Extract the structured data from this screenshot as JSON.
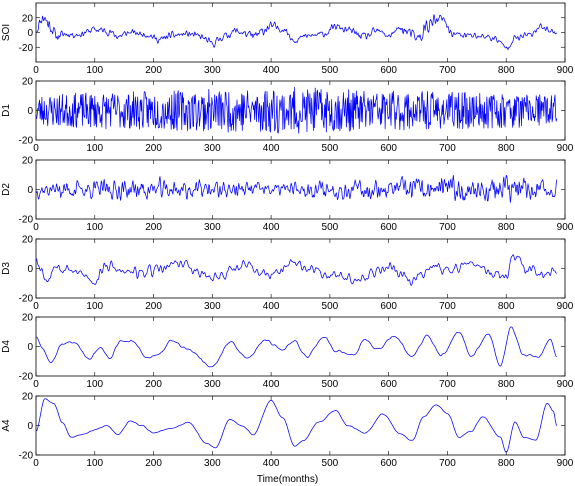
{
  "chart_data": {
    "type": "line",
    "layout": "6 vertically stacked subplots sharing the x axis",
    "xlabel": "Time(months)",
    "xlim": [
      0,
      900
    ],
    "xticks": [
      0,
      100,
      200,
      300,
      400,
      500,
      600,
      700,
      800,
      900
    ],
    "x_data_range": [
      1,
      886
    ],
    "grid": false,
    "line_color": "#0000ff",
    "panels": [
      {
        "ylabel": "SOI",
        "ylim": [
          -40,
          40
        ],
        "yticks": [
          -20,
          0,
          20
        ],
        "key": "soi",
        "envelope": [
          [
            0,
            18
          ],
          [
            15,
            32
          ],
          [
            40,
            14
          ],
          [
            70,
            10
          ],
          [
            100,
            12
          ],
          [
            150,
            12
          ],
          [
            180,
            9
          ],
          [
            250,
            12
          ],
          [
            300,
            12
          ],
          [
            400,
            16
          ],
          [
            420,
            12
          ],
          [
            450,
            9
          ],
          [
            500,
            10
          ],
          [
            550,
            14
          ],
          [
            600,
            10
          ],
          [
            670,
            28
          ],
          [
            700,
            12
          ],
          [
            750,
            11
          ],
          [
            800,
            10
          ],
          [
            850,
            12
          ],
          [
            886,
            8
          ]
        ],
        "anchors": [
          [
            0,
            5
          ],
          [
            12,
            22
          ],
          [
            22,
            12
          ],
          [
            35,
            -5
          ],
          [
            50,
            -2
          ],
          [
            70,
            -3
          ],
          [
            100,
            4
          ],
          [
            120,
            2
          ],
          [
            140,
            -5
          ],
          [
            160,
            0
          ],
          [
            190,
            -3
          ],
          [
            210,
            -10
          ],
          [
            230,
            -4
          ],
          [
            260,
            -2
          ],
          [
            280,
            -6
          ],
          [
            300,
            -15
          ],
          [
            320,
            -5
          ],
          [
            340,
            2
          ],
          [
            370,
            -5
          ],
          [
            400,
            8
          ],
          [
            420,
            5
          ],
          [
            440,
            -10
          ],
          [
            460,
            -5
          ],
          [
            490,
            -2
          ],
          [
            510,
            8
          ],
          [
            530,
            3
          ],
          [
            560,
            -6
          ],
          [
            580,
            2
          ],
          [
            600,
            -4
          ],
          [
            620,
            5
          ],
          [
            650,
            -8
          ],
          [
            670,
            12
          ],
          [
            690,
            18
          ],
          [
            710,
            -2
          ],
          [
            730,
            -4
          ],
          [
            760,
            -5
          ],
          [
            780,
            -8
          ],
          [
            800,
            -20
          ],
          [
            815,
            -8
          ],
          [
            840,
            -3
          ],
          [
            860,
            8
          ],
          [
            886,
            0
          ]
        ]
      },
      {
        "ylabel": "D1",
        "ylim": [
          -20,
          20
        ],
        "yticks": [
          -20,
          0,
          20
        ],
        "key": "d1",
        "envelope": [
          [
            0,
            11
          ],
          [
            440,
            16
          ],
          [
            540,
            14
          ],
          [
            886,
            11
          ]
        ],
        "anchors": [
          [
            0,
            0
          ],
          [
            886,
            0
          ]
        ]
      },
      {
        "ylabel": "D2",
        "ylim": [
          -20,
          20
        ],
        "yticks": [
          -20,
          0,
          20
        ],
        "key": "d2",
        "envelope": [
          [
            0,
            7
          ],
          [
            230,
            9
          ],
          [
            400,
            6
          ],
          [
            800,
            12
          ],
          [
            886,
            7
          ]
        ],
        "anchors": [
          [
            0,
            0
          ],
          [
            886,
            0
          ]
        ]
      },
      {
        "ylabel": "D3",
        "ylim": [
          -20,
          20
        ],
        "yticks": [
          -20,
          0,
          20
        ],
        "key": "d3",
        "envelope": [
          [
            0,
            5
          ],
          [
            886,
            5
          ]
        ],
        "anchors": [
          [
            0,
            12
          ],
          [
            5,
            2
          ],
          [
            20,
            -7
          ],
          [
            35,
            3
          ],
          [
            50,
            1
          ],
          [
            75,
            -4
          ],
          [
            100,
            -8
          ],
          [
            120,
            2
          ],
          [
            150,
            -3
          ],
          [
            200,
            -2
          ],
          [
            240,
            4
          ],
          [
            300,
            -6
          ],
          [
            350,
            2
          ],
          [
            400,
            -5
          ],
          [
            440,
            3
          ],
          [
            500,
            -4
          ],
          [
            560,
            -6
          ],
          [
            600,
            2
          ],
          [
            640,
            -8
          ],
          [
            680,
            3
          ],
          [
            700,
            -2
          ],
          [
            740,
            4
          ],
          [
            780,
            -4
          ],
          [
            800,
            -6
          ],
          [
            812,
            9
          ],
          [
            830,
            1
          ],
          [
            860,
            -4
          ],
          [
            886,
            -3
          ]
        ]
      },
      {
        "ylabel": "D4",
        "ylim": [
          -20,
          20
        ],
        "yticks": [
          -20,
          0,
          20
        ],
        "key": "d4",
        "envelope": [
          [
            0,
            1
          ],
          [
            886,
            1
          ]
        ],
        "anchors": [
          [
            0,
            7
          ],
          [
            10,
            -1
          ],
          [
            25,
            -11
          ],
          [
            45,
            2
          ],
          [
            65,
            3
          ],
          [
            90,
            -8
          ],
          [
            110,
            -1
          ],
          [
            125,
            -8
          ],
          [
            145,
            4
          ],
          [
            165,
            3
          ],
          [
            190,
            -8
          ],
          [
            210,
            -5
          ],
          [
            230,
            4
          ],
          [
            260,
            -2
          ],
          [
            300,
            -14
          ],
          [
            330,
            3
          ],
          [
            360,
            -8
          ],
          [
            390,
            4
          ],
          [
            420,
            -2
          ],
          [
            440,
            4
          ],
          [
            460,
            -7
          ],
          [
            490,
            6
          ],
          [
            510,
            -3
          ],
          [
            540,
            -6
          ],
          [
            560,
            5
          ],
          [
            580,
            -2
          ],
          [
            610,
            7
          ],
          [
            640,
            -7
          ],
          [
            665,
            7
          ],
          [
            690,
            -6
          ],
          [
            720,
            10
          ],
          [
            740,
            -6
          ],
          [
            770,
            8
          ],
          [
            790,
            -13
          ],
          [
            808,
            13
          ],
          [
            830,
            -6
          ],
          [
            855,
            -7
          ],
          [
            875,
            5
          ],
          [
            886,
            -7
          ]
        ]
      },
      {
        "ylabel": "A4",
        "ylim": [
          -20,
          20
        ],
        "yticks": [
          -20,
          0,
          20
        ],
        "key": "a4",
        "envelope": [
          [
            0,
            0.5
          ],
          [
            886,
            0.5
          ]
        ],
        "anchors": [
          [
            0,
            -4
          ],
          [
            15,
            18
          ],
          [
            30,
            15
          ],
          [
            45,
            2
          ],
          [
            60,
            -8
          ],
          [
            80,
            -6
          ],
          [
            100,
            -3
          ],
          [
            120,
            0
          ],
          [
            140,
            -6
          ],
          [
            160,
            3
          ],
          [
            180,
            0
          ],
          [
            200,
            -5
          ],
          [
            230,
            -2
          ],
          [
            260,
            2
          ],
          [
            290,
            -12
          ],
          [
            305,
            -15
          ],
          [
            330,
            4
          ],
          [
            350,
            0
          ],
          [
            370,
            -6
          ],
          [
            400,
            17
          ],
          [
            420,
            5
          ],
          [
            440,
            -14
          ],
          [
            455,
            -10
          ],
          [
            480,
            2
          ],
          [
            510,
            10
          ],
          [
            530,
            0
          ],
          [
            560,
            -5
          ],
          [
            590,
            8
          ],
          [
            620,
            -6
          ],
          [
            640,
            -10
          ],
          [
            660,
            6
          ],
          [
            680,
            14
          ],
          [
            700,
            8
          ],
          [
            720,
            -8
          ],
          [
            740,
            -4
          ],
          [
            760,
            6
          ],
          [
            790,
            -8
          ],
          [
            800,
            -18
          ],
          [
            815,
            2
          ],
          [
            830,
            -8
          ],
          [
            850,
            -10
          ],
          [
            870,
            15
          ],
          [
            880,
            10
          ],
          [
            886,
            0
          ]
        ]
      }
    ]
  }
}
